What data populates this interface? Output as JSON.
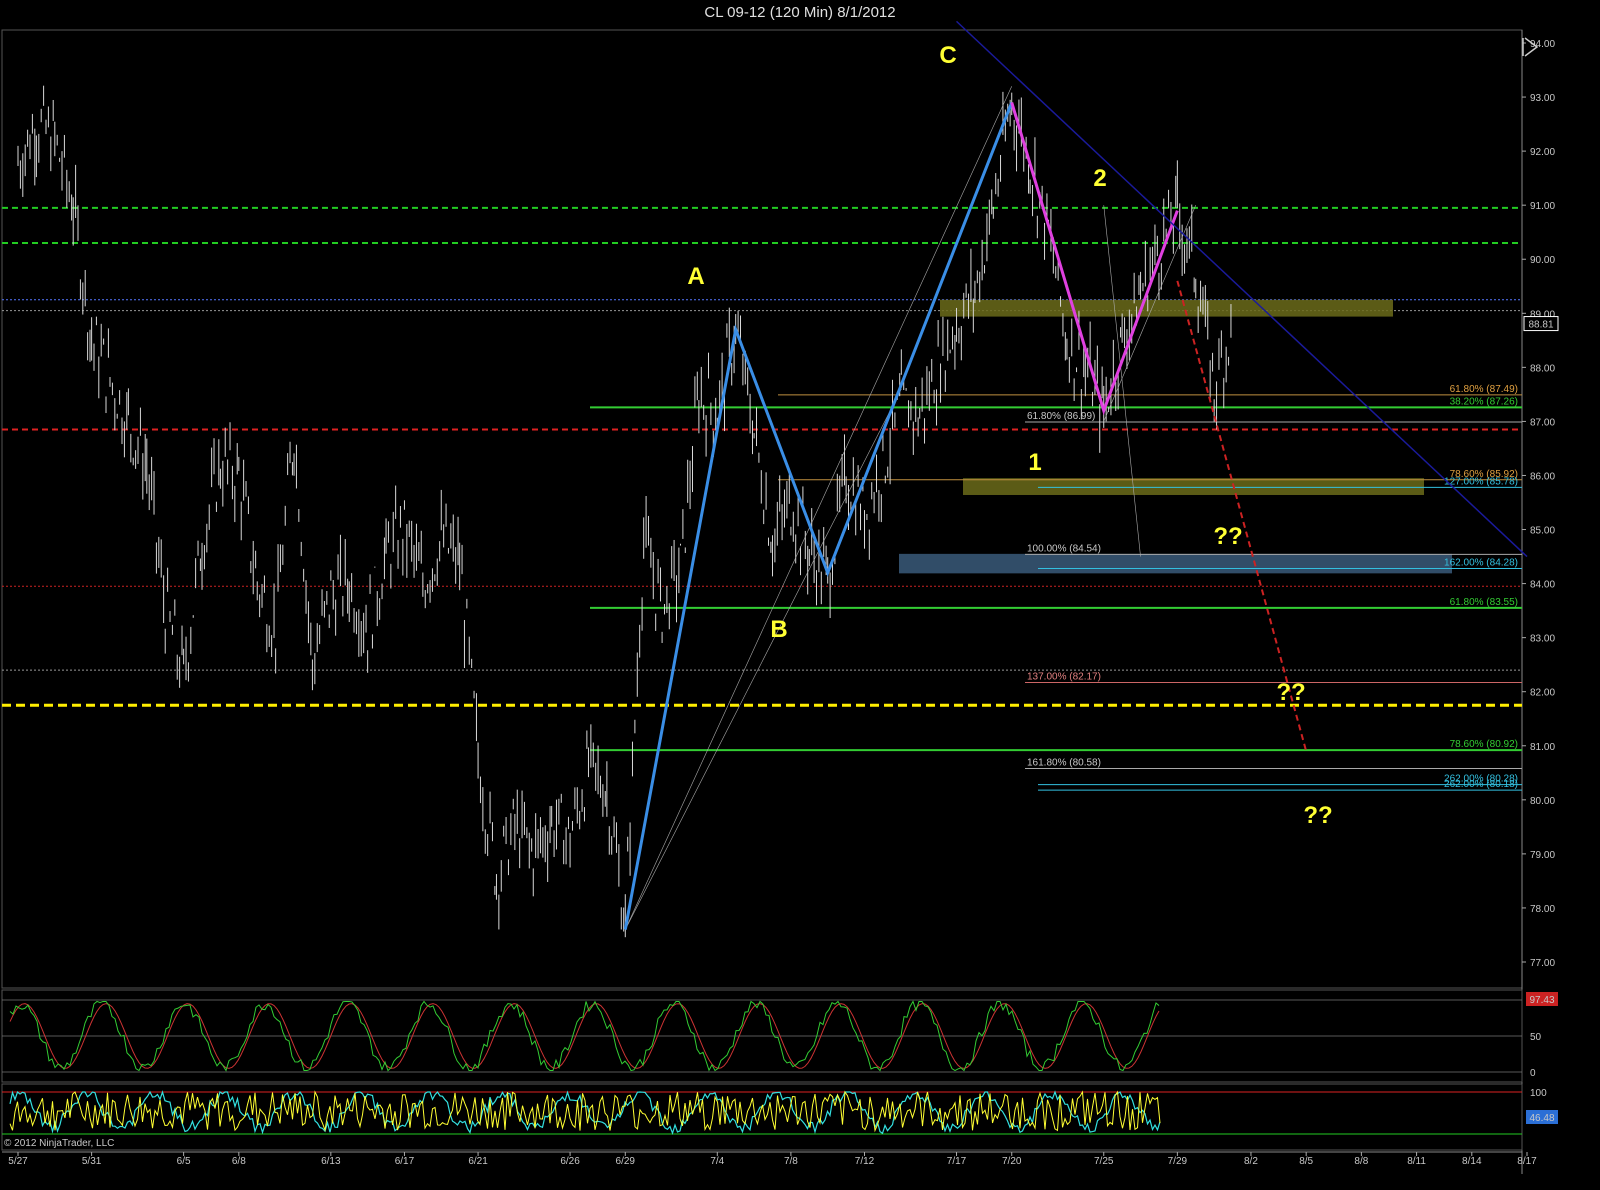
{
  "window": {
    "title": "CL 09-12 (120 Min)  8/1/2012"
  },
  "copyright": "© 2012 NinjaTrader, LLC",
  "colors": {
    "background": "#000000",
    "candles": "#d8d8d8",
    "abc_pattern": "#3a8ee6",
    "magenta_leg": "#e040e0",
    "labels": "#ffff33",
    "fib_green": "#33cc33",
    "fib_yellow_dashed": "#ffff00",
    "red_dashed": "#cc2222",
    "trendline_blue": "#1a1a9a",
    "stoch_k": "#33cc33",
    "stoch_d": "#cc3333",
    "cci_yellow": "#ffff33",
    "cci_cyan": "#33e0e0"
  },
  "chart_data": [
    {
      "type": "candlestick",
      "title": "CL 09-12 (120 Min)  8/1/2012",
      "ylim": [
        76.5,
        94.5
      ],
      "y_ticks": [
        "94.00",
        "93.00",
        "92.00",
        "91.00",
        "90.00",
        "89.00",
        "88.00",
        "87.00",
        "86.00",
        "85.00",
        "84.00",
        "83.00",
        "82.00",
        "81.00",
        "80.00",
        "79.00",
        "78.00",
        "77.00"
      ],
      "x_ticks": [
        "5/27",
        "5/31",
        "6/5",
        "6/8",
        "6/13",
        "6/17",
        "6/21",
        "6/26",
        "6/29",
        "7/4",
        "7/8",
        "7/12",
        "7/17",
        "7/20",
        "7/25",
        "7/29",
        "8/2",
        "8/5",
        "8/8",
        "8/11",
        "8/14",
        "8/17"
      ],
      "last_price": "88.81",
      "price_path": [
        {
          "x": "5/27",
          "y": 91.8
        },
        {
          "x": "5/28",
          "y": 92.5
        },
        {
          "x": "5/29",
          "y": 92.2
        },
        {
          "x": "5/30",
          "y": 91.0
        },
        {
          "x": "5/31",
          "y": 88.5
        },
        {
          "x": "6/1",
          "y": 87.8
        },
        {
          "x": "6/2",
          "y": 87.0
        },
        {
          "x": "6/3",
          "y": 86.2
        },
        {
          "x": "6/4",
          "y": 83.5
        },
        {
          "x": "6/5",
          "y": 82.3
        },
        {
          "x": "6/6",
          "y": 84.8
        },
        {
          "x": "6/7",
          "y": 86.2
        },
        {
          "x": "6/8",
          "y": 86.0
        },
        {
          "x": "6/9",
          "y": 84.0
        },
        {
          "x": "6/10",
          "y": 83.2
        },
        {
          "x": "6/11",
          "y": 86.8
        },
        {
          "x": "6/12",
          "y": 82.5
        },
        {
          "x": "6/13",
          "y": 83.8
        },
        {
          "x": "6/14",
          "y": 84.0
        },
        {
          "x": "6/15",
          "y": 83.2
        },
        {
          "x": "6/16",
          "y": 84.5
        },
        {
          "x": "6/17",
          "y": 85.0
        },
        {
          "x": "6/18",
          "y": 84.0
        },
        {
          "x": "6/19",
          "y": 84.8
        },
        {
          "x": "6/20",
          "y": 84.4
        },
        {
          "x": "6/21",
          "y": 80.8
        },
        {
          "x": "6/22",
          "y": 78.6
        },
        {
          "x": "6/23",
          "y": 79.5
        },
        {
          "x": "6/24",
          "y": 79.0
        },
        {
          "x": "6/25",
          "y": 79.6
        },
        {
          "x": "6/26",
          "y": 79.3
        },
        {
          "x": "6/27",
          "y": 80.6
        },
        {
          "x": "6/28",
          "y": 80.2
        },
        {
          "x": "6/29",
          "y": 77.7
        },
        {
          "x": "6/30",
          "y": 84.8
        },
        {
          "x": "7/1",
          "y": 83.5
        },
        {
          "x": "7/2",
          "y": 84.3
        },
        {
          "x": "7/3",
          "y": 87.5
        },
        {
          "x": "7/4",
          "y": 87.2
        },
        {
          "x": "7/5",
          "y": 88.7
        },
        {
          "x": "7/6",
          "y": 86.8
        },
        {
          "x": "7/7",
          "y": 84.8
        },
        {
          "x": "7/8",
          "y": 85.5
        },
        {
          "x": "7/9",
          "y": 84.6
        },
        {
          "x": "7/10",
          "y": 84.1
        },
        {
          "x": "7/11",
          "y": 86.0
        },
        {
          "x": "7/12",
          "y": 85.3
        },
        {
          "x": "7/13",
          "y": 86.2
        },
        {
          "x": "7/14",
          "y": 87.3
        },
        {
          "x": "7/15",
          "y": 87.1
        },
        {
          "x": "7/16",
          "y": 88.0
        },
        {
          "x": "7/17",
          "y": 88.8
        },
        {
          "x": "7/18",
          "y": 89.4
        },
        {
          "x": "7/19",
          "y": 91.0
        },
        {
          "x": "7/20",
          "y": 92.9
        },
        {
          "x": "7/21",
          "y": 91.8
        },
        {
          "x": "7/22",
          "y": 90.5
        },
        {
          "x": "7/23",
          "y": 88.5
        },
        {
          "x": "7/24",
          "y": 88.0
        },
        {
          "x": "7/25",
          "y": 87.2
        },
        {
          "x": "7/26",
          "y": 88.5
        },
        {
          "x": "7/27",
          "y": 89.4
        },
        {
          "x": "7/28",
          "y": 90.2
        },
        {
          "x": "7/29",
          "y": 90.9
        },
        {
          "x": "7/30",
          "y": 89.8
        },
        {
          "x": "7/31",
          "y": 87.6
        },
        {
          "x": "8/1",
          "y": 88.81
        }
      ],
      "pattern_points": {
        "X": {
          "x": "6/29",
          "y": 77.6
        },
        "A": {
          "x": "7/5",
          "y": 88.7
        },
        "B": {
          "x": "7/10",
          "y": 84.2
        },
        "C": {
          "x": "7/20",
          "y": 92.9
        },
        "1": {
          "x": "7/25",
          "y": 87.2
        },
        "2": {
          "x": "7/29",
          "y": 90.9
        }
      },
      "pattern_labels": [
        "A",
        "B",
        "C",
        "1",
        "2"
      ],
      "question_marks": [
        "??",
        "??",
        "??"
      ],
      "horizontal_levels": [
        {
          "price": 90.95,
          "style": "green-dashed"
        },
        {
          "price": 90.3,
          "style": "green-dashed"
        },
        {
          "price": 89.25,
          "style": "blue-dotted"
        },
        {
          "price": 89.05,
          "style": "gray-dotted"
        },
        {
          "price": 86.85,
          "style": "red-dashed"
        },
        {
          "price": 83.95,
          "style": "red-dotted"
        },
        {
          "price": 82.4,
          "style": "gray-dotted"
        },
        {
          "price": 81.75,
          "style": "yellow-dashed"
        }
      ],
      "fib_labels": [
        {
          "text": "61.80% (87.49)",
          "price": 87.49,
          "color": "#e0a040"
        },
        {
          "text": "38.20% (87.26)",
          "price": 87.26,
          "color": "#33cc33"
        },
        {
          "text": "61.80% (86.99)",
          "price": 86.99,
          "color": "#c8c8c8"
        },
        {
          "text": "78.60% (85.92)",
          "price": 85.92,
          "color": "#e0a040"
        },
        {
          "text": "127.00% (85.78)",
          "price": 85.78,
          "color": "#33c0e0"
        },
        {
          "text": "100.00% (84.54)",
          "price": 84.54,
          "color": "#c8c8c8"
        },
        {
          "text": "162.00% (84.28)",
          "price": 84.28,
          "color": "#33c0e0"
        },
        {
          "text": "61.80% (83.55)",
          "price": 83.55,
          "color": "#33cc33"
        },
        {
          "text": "137.00% (82.17)",
          "price": 82.17,
          "color": "#e08080"
        },
        {
          "text": "78.60% (80.92)",
          "price": 80.92,
          "color": "#33cc33"
        },
        {
          "text": "161.80% (80.58)",
          "price": 80.58,
          "color": "#c8c8c8"
        },
        {
          "text": "262.00% (80.28)",
          "price": 80.28,
          "color": "#33c0e0"
        },
        {
          "text": "262.00% (80.18)",
          "price": 80.18,
          "color": "#33c0e0"
        }
      ],
      "zones": [
        {
          "from_price": 89.05,
          "to_price": 89.25,
          "color": "#6b6b1a"
        },
        {
          "from_price": 85.75,
          "to_price": 85.95,
          "color": "#6b6b1a"
        },
        {
          "from_price": 84.3,
          "to_price": 84.55,
          "color": "#3a5a7a"
        }
      ],
      "projection": {
        "from": {
          "x": "7/29",
          "y": 89.6
        },
        "to": {
          "x": "8/5",
          "y": 80.9
        }
      },
      "trendline": {
        "from": {
          "x": "7/17",
          "y": 94.4
        },
        "to": {
          "x": "8/17",
          "y": 84.5
        }
      }
    },
    {
      "type": "line",
      "title": "",
      "ylim": [
        0,
        100
      ],
      "y_ticks": [
        "50",
        "0"
      ],
      "last_value": "97.43",
      "series": []
    },
    {
      "type": "line",
      "title": "",
      "y_ticks": [
        "100"
      ],
      "last_value": "46.48",
      "series": []
    }
  ]
}
